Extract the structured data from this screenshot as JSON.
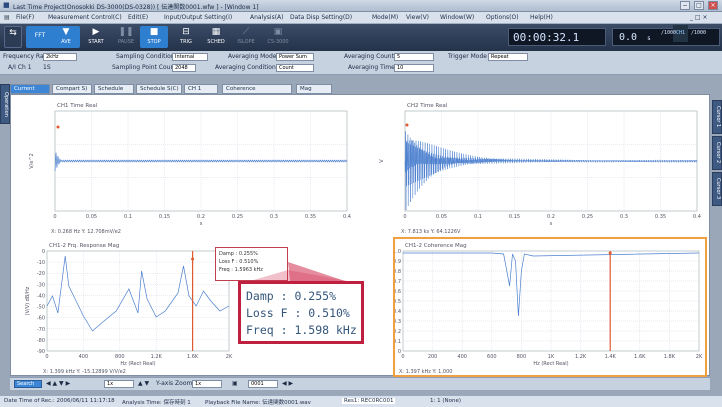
{
  "titlebar": {
    "title": "Last Time Project(Onosokki DS-3000(DS-0328)) [ 伝達関数0001.wfw ] - [Window 1]"
  },
  "menu": [
    "File(F)",
    "Measurement Control(C)",
    "Edit(E)",
    "Input/Output Setting(I)",
    "Analysis(A)",
    "Data Disp Setting(D)",
    "Mode(M)",
    "View(V)",
    "Window(W)",
    "Options(O)",
    "Help(H)"
  ],
  "toolbar": {
    "buttons": [
      {
        "label": "FFT",
        "icon": "waveform-icon"
      },
      {
        "label": "AVE",
        "icon": "average-icon"
      },
      {
        "label": "START",
        "icon": "play-icon"
      },
      {
        "label": "PAUSE",
        "icon": "pause-icon"
      },
      {
        "label": "STOP",
        "icon": "stop-icon"
      },
      {
        "label": "TRIG",
        "icon": "trigger-icon"
      },
      {
        "label": "SCHED",
        "icon": "schedule-icon"
      },
      {
        "label": "ISLOPE",
        "icon": "slope-icon"
      },
      {
        "label": "CS-3000",
        "icon": "device-icon"
      }
    ],
    "time": "00:00:32.1",
    "level": "0.0",
    "level_unit": "s",
    "range_hi": "/1000",
    "range_lo": "/1000",
    "ch_label": "CH1"
  },
  "params": {
    "frequency_range_label": "Frequency Range",
    "frequency_range": "2kHz",
    "ch_label": "A/I Ch 1",
    "ch_value": "1S",
    "sampling_condition_label": "Sampling Condition",
    "sampling_condition": "Internal",
    "sampling_point_label": "Sampling Point Count",
    "sampling_point": "2048",
    "averaging_mode_label": "Averaging Mode",
    "averaging_mode": "Power Sum",
    "averaging_condition_label": "Averaging Condition",
    "averaging_condition": "Count",
    "averaging_count_label": "Averaging Count",
    "averaging_count": "5",
    "averaging_time_label": "Averaging Time",
    "averaging_time": "10",
    "trigger_mode_label": "Trigger Mode",
    "trigger_mode": "Repeat"
  },
  "tabs": [
    "Current",
    "Compart S)",
    "Schedule",
    "Schedule S(C)",
    "CH 1",
    "Coherence",
    "Mag"
  ],
  "side_tabs_left": [
    "Operation"
  ],
  "side_tabs_right": [
    "Cursor 1",
    "Cursor 2",
    "Cursor 3"
  ],
  "panels": [
    {
      "title": "CH1 Time Real",
      "ylabel": "V/e^2",
      "xlabel": "s",
      "xticks": [
        "0",
        "0.05",
        "0.1",
        "0.15",
        "0.2",
        "0.25",
        "0.3",
        "0.35",
        "0.4"
      ],
      "yticks": [
        "",
        "",
        "",
        ""
      ],
      "readout": "X: 0.268 Hz  Y: 12.708mV/e2"
    },
    {
      "title": "CH2 Time Real",
      "ylabel": "V",
      "xlabel": "s",
      "xticks": [
        "0",
        "0.05",
        "0.1",
        "0.15",
        "0.2",
        "0.25",
        "0.3",
        "0.35",
        "0.4"
      ],
      "yticks": [
        "",
        "",
        "",
        ""
      ],
      "readout": "X: 7.813 ks  Y: 64.1226V"
    },
    {
      "title": "CH1-2 Frq. Response Mag",
      "ylabel": "(V/V) dB/Hz",
      "xlabel": "Hz (Rect Real)",
      "xticks": [
        "0",
        "400",
        "800",
        "1.2K",
        "1.6K",
        "2K"
      ],
      "yticks": [
        "0",
        "-10",
        "-20",
        "-30",
        "-40",
        "-50",
        "-60",
        "-70",
        "-80",
        "-90"
      ],
      "readout": "X: 1.399 kHz  Y: -15.12899 V/V/e2"
    },
    {
      "title": "CH1-2 Coherence Mag",
      "ylabel": "",
      "xlabel": "Hz (Rect Real)",
      "xticks": [
        "0",
        "200",
        "400",
        "600",
        "800",
        "1K",
        "1.2K",
        "1.4K",
        "1.6K",
        "1.8K",
        "2K"
      ],
      "yticks": [
        "1.0",
        "0.9",
        "0.8",
        "0.7",
        "0.6",
        "0.5",
        "0.4",
        "0.3",
        "0.2",
        "0.1",
        "0"
      ],
      "readout": "X: 1.397 kHz  Y: 1.000"
    }
  ],
  "small_box": {
    "damp": "Damp : 0.255%",
    "loss": "Loss F : 0.510%",
    "freq": "Freq : 1.5963 kHz"
  },
  "callout": {
    "damp": "Damp : 0.255%",
    "loss": "Loss F : 0.510%",
    "freq": "Freq : 1.598 kHz"
  },
  "bottom": {
    "search_label": "Search",
    "display_count": "1x",
    "zoom_label": "Y-axis Zoom",
    "zoom_value": "1x",
    "frame": "0001"
  },
  "status": {
    "date_label": "Date Time of Rec.: 2006/06/11 11:17:18",
    "analysis_label": "Analysis Time: 保存時刻 1",
    "playback_label": "Playback File Name: 伝達関数0001.wav",
    "file_value": "Res1: REC0RC001",
    "misc": "1: 1 (None)"
  }
}
